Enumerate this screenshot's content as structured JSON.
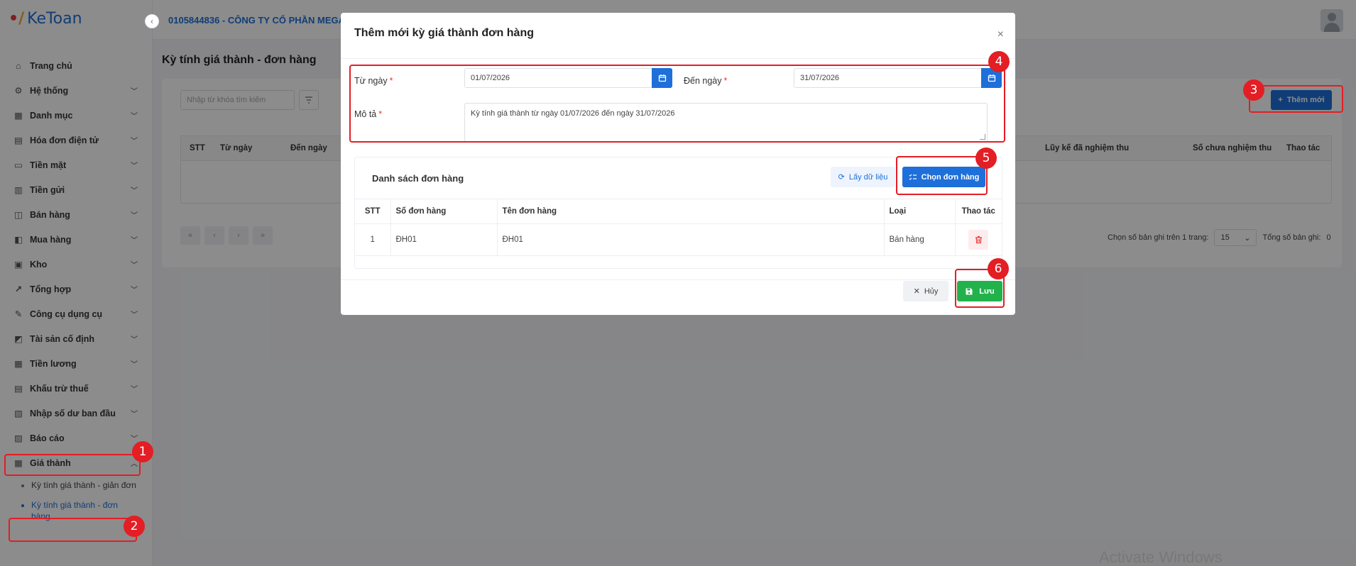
{
  "app": {
    "logo_text": "KeToan"
  },
  "topbar": {
    "company": "0105844836 - CÔNG TY CỔ PHẦN MEGA"
  },
  "sidebar": {
    "items": [
      {
        "label": "Trang chủ",
        "icon": "home-icon",
        "chevron": false
      },
      {
        "label": "Hệ thống",
        "icon": "gear-icon",
        "chevron": true
      },
      {
        "label": "Danh mục",
        "icon": "grid-icon",
        "chevron": true
      },
      {
        "label": "Hóa đơn điện tử",
        "icon": "invoice-icon",
        "chevron": true
      },
      {
        "label": "Tiền mặt",
        "icon": "cash-icon",
        "chevron": true
      },
      {
        "label": "Tiền gửi",
        "icon": "bank-icon",
        "chevron": true
      },
      {
        "label": "Bán hàng",
        "icon": "sales-icon",
        "chevron": true
      },
      {
        "label": "Mua hàng",
        "icon": "cart-icon",
        "chevron": true
      },
      {
        "label": "Kho",
        "icon": "warehouse-icon",
        "chevron": true
      },
      {
        "label": "Tổng hợp",
        "icon": "chart-icon",
        "chevron": true
      },
      {
        "label": "Công cụ dụng cụ",
        "icon": "tools-icon",
        "chevron": true
      },
      {
        "label": "Tài sản cố định",
        "icon": "car-icon",
        "chevron": true
      },
      {
        "label": "Tiền lương",
        "icon": "salary-icon",
        "chevron": true
      },
      {
        "label": "Khấu trừ thuế",
        "icon": "tax-icon",
        "chevron": true
      },
      {
        "label": "Nhập số dư ban đầu",
        "icon": "balance-icon",
        "chevron": true
      },
      {
        "label": "Báo cáo",
        "icon": "report-icon",
        "chevron": true
      },
      {
        "label": "Giá thành",
        "icon": "cost-icon",
        "chevron": true
      }
    ],
    "sub_items": [
      {
        "label": "Kỳ tính giá thành - giản đơn"
      },
      {
        "label": "Kỳ tính giá thành - đơn hàng"
      }
    ]
  },
  "main": {
    "page_title": "Kỳ tính giá thành - đơn hàng",
    "search_placeholder": "Nhập từ khóa tìm kiếm",
    "add_new_label": "Thêm mới",
    "table_headers": {
      "stt": "STT",
      "from": "Từ ngày",
      "to": "Đến ngày",
      "accumulated": "Lũy kế đã nghiệm thu",
      "unaccepted": "Số chưa nghiệm thu",
      "action": "Thao tác"
    },
    "pager": {
      "per_page_label": "Chọn số bản ghi trên 1 trang:",
      "per_page_value": "15",
      "total_label": "Tổng số bản ghi:",
      "total_value": "0"
    }
  },
  "modal": {
    "title": "Thêm mới kỳ giá thành đơn hàng",
    "from_label": "Từ ngày",
    "from_value": "01/07/2026",
    "to_label": "Đến ngày",
    "to_value": "31/07/2026",
    "desc_label": "Mô tả",
    "desc_value": "Kỳ tính giá thành từ ngày 01/07/2026 đến ngày 31/07/2026",
    "required_mark": "*",
    "orders_title": "Danh sách đơn hàng",
    "fetch_label": "Lấy dữ liệu",
    "choose_label": "Chọn đơn hàng",
    "columns": {
      "stt": "STT",
      "order_no": "Số đơn hàng",
      "order_name": "Tên đơn hàng",
      "type": "Loại",
      "action": "Thao tác"
    },
    "rows": [
      {
        "stt": "1",
        "order_no": "ĐH01",
        "order_name": "ĐH01",
        "type": "Bán hàng"
      }
    ],
    "cancel_label": "Hủy",
    "save_label": "Lưu"
  },
  "annotations": [
    "1",
    "2",
    "3",
    "4",
    "5",
    "6"
  ],
  "watermark": "Activate Windows",
  "colors": {
    "primary": "#1e6fd9",
    "success": "#22b24c",
    "annotation": "#e31e24",
    "danger": "#e53935"
  }
}
